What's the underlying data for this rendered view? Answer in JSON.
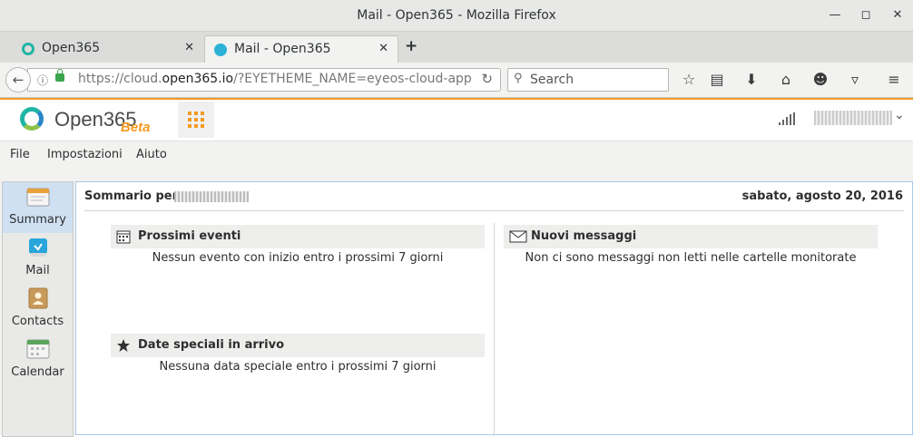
{
  "window": {
    "title": "Mail - Open365 - Mozilla Firefox"
  },
  "tabs": [
    {
      "label": "Open365",
      "close": "✕"
    },
    {
      "label": "Mail - Open365",
      "close": "✕"
    }
  ],
  "newtab": "+",
  "nav": {
    "back": "←",
    "url_prefix": "https://cloud.",
    "url_domain": "open365.io",
    "url_suffix": "/?EYETHEME_NAME=eyeos-cloud-app",
    "reload": "↻",
    "search_placeholder": "Search"
  },
  "app": {
    "brand": "Open365",
    "beta": "Beta"
  },
  "menu": {
    "file": "File",
    "settings": "Impostazioni",
    "help": "Aiuto"
  },
  "sidebar": {
    "items": [
      {
        "label": "Summary"
      },
      {
        "label": "Mail"
      },
      {
        "label": "Contacts"
      },
      {
        "label": "Calendar"
      }
    ]
  },
  "summary": {
    "heading": "Sommario per",
    "date": "sabato, agosto 20, 2016",
    "events": {
      "title": "Prossimi eventi",
      "message": "Nessun evento con inizio entro i prossimi 7 giorni"
    },
    "messages": {
      "title": "Nuovi messaggi",
      "message": "Non ci sono messaggi non letti nelle cartelle monitorate"
    },
    "special": {
      "title": "Date speciali in arrivo",
      "message": "Nessuna data speciale entro i prossimi 7 giorni"
    }
  },
  "colors": {
    "accent": "#f39a1f",
    "selection": "#cfe0f3"
  }
}
